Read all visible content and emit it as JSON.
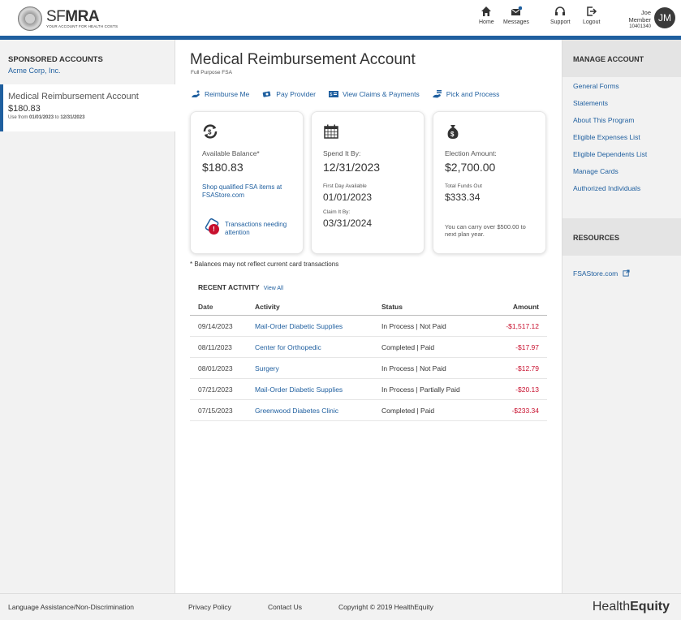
{
  "header": {
    "logo_name_light": "SF",
    "logo_name_bold": "MRA",
    "logo_tagline": "YOUR ACCOUNT FOR HEALTH COSTS",
    "nav": [
      {
        "label": "Home",
        "icon": "home-icon"
      },
      {
        "label": "Messages",
        "icon": "envelope-icon"
      },
      {
        "label": "Support",
        "icon": "headset-icon"
      },
      {
        "label": "Logout",
        "icon": "logout-icon"
      }
    ],
    "user_name": "Joe Member",
    "user_id": "10401340",
    "avatar_initials": "JM"
  },
  "left": {
    "section_title": "SPONSORED ACCOUNTS",
    "company": "Acme Corp, Inc.",
    "account_name": "Medical Reimbursement Account",
    "account_balance": "$180.83",
    "use_prefix": "Use from",
    "use_from": "01/01/2023",
    "use_to_word": "to",
    "use_to": "12/31/2023"
  },
  "main": {
    "title": "Medical Reimbursement Account",
    "subtitle": "Full Purpose FSA",
    "actions": [
      "Reimburse Me",
      "Pay Provider",
      "View Claims & Payments",
      "Pick and Process"
    ],
    "card1": {
      "label": "Available Balance*",
      "value": "$180.83",
      "link": "Shop qualified FSA items at FSAStore.com",
      "badge": "!",
      "tx_link": "Transactions needing attention"
    },
    "card2": {
      "label": "Spend It By:",
      "value": "12/31/2023",
      "first_day_label": "First Day Available",
      "first_day_value": "01/01/2023",
      "claim_label": "Claim It By:",
      "claim_value": "03/31/2024"
    },
    "card3": {
      "label": "Election Amount:",
      "value": "$2,700.00",
      "funds_label": "Total Funds Out",
      "funds_value": "$333.34",
      "note": "You can carry over $500.00 to next plan year."
    },
    "disclaimer": "* Balances may not reflect current card transactions",
    "recent_title": "RECENT ACTIVITY",
    "view_all": "View All",
    "table": {
      "headers": [
        "Date",
        "Activity",
        "Status",
        "Amount"
      ],
      "rows": [
        {
          "date": "09/14/2023",
          "activity": "Mail-Order Diabetic Supplies",
          "status": "In Process | Not Paid",
          "amount": "-$1,517.12"
        },
        {
          "date": "08/11/2023",
          "activity": "Center for Orthopedic",
          "status": "Completed | Paid",
          "amount": "-$17.97"
        },
        {
          "date": "08/01/2023",
          "activity": "Surgery",
          "status": "In Process | Not Paid",
          "amount": "-$12.79"
        },
        {
          "date": "07/21/2023",
          "activity": "Mail-Order Diabetic Supplies",
          "status": "In Process | Partially Paid",
          "amount": "-$20.13"
        },
        {
          "date": "07/15/2023",
          "activity": "Greenwood Diabetes Clinic",
          "status": "Completed | Paid",
          "amount": "-$233.34"
        }
      ]
    }
  },
  "right": {
    "manage_title": "MANAGE ACCOUNT",
    "links": [
      "General Forms",
      "Statements",
      "About This Program",
      "Eligible Expenses List",
      "Eligible Dependents List",
      "Manage Cards",
      "Authorized Individuals"
    ],
    "resources_title": "RESOURCES",
    "resource_link": "FSAStore.com"
  },
  "footer": {
    "links": [
      "Language Assistance/Non-Discrimination",
      "Privacy Policy",
      "Contact Us"
    ],
    "copyright": "Copyright © 2019 HealthEquity",
    "brand_light": "Health",
    "brand_bold": "Equity"
  },
  "colors": {
    "brand_blue": "#1f5f9f",
    "negative_red": "#c8102e"
  }
}
